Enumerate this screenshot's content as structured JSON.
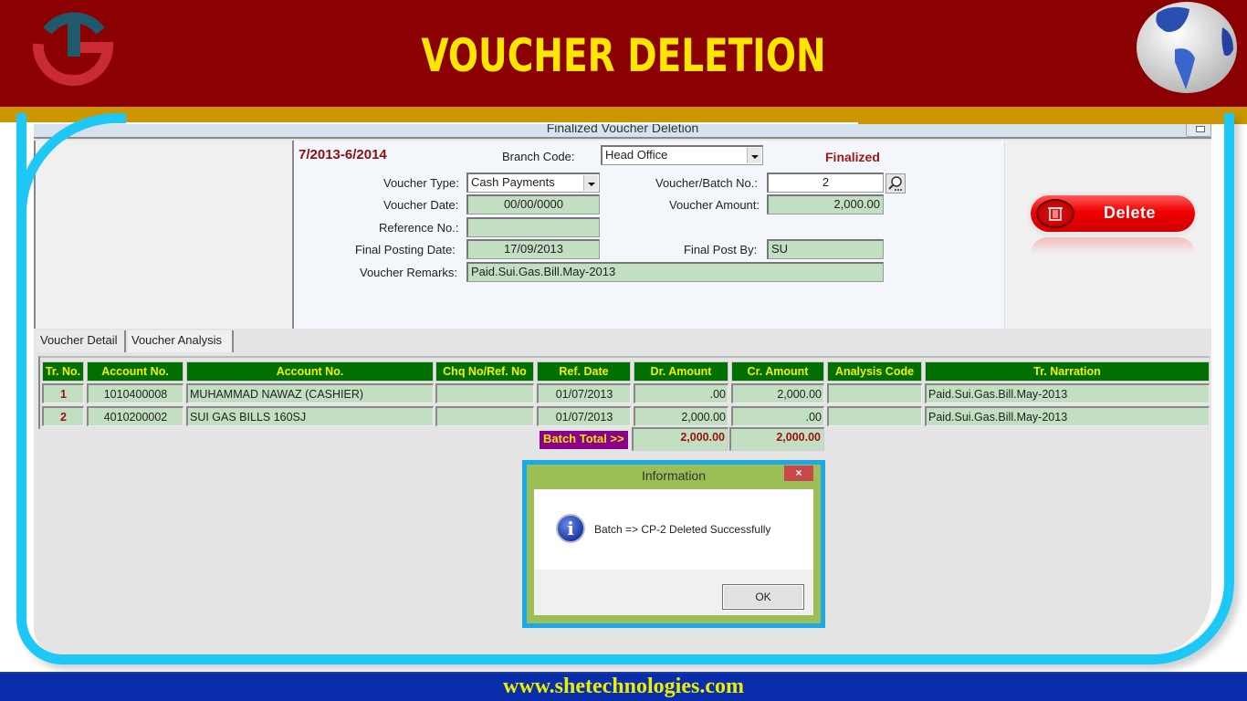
{
  "slide": {
    "title": "VOUCHER DELETION",
    "footer_url": "www.shetechnologies.com",
    "colors": {
      "header_bg": "#8b0000",
      "title": "#ffe600",
      "gold_band": "#cc9600",
      "frame": "#1ec8f6",
      "footer_bg": "#0a2eab"
    }
  },
  "window": {
    "title": "Finalized Voucher Deletion"
  },
  "form": {
    "period": "7/2013-6/2014",
    "status": "Finalized",
    "branch_code": {
      "label": "Branch Code:",
      "value": "Head Office"
    },
    "voucher_type": {
      "label": "Voucher Type:",
      "value": "Cash Payments"
    },
    "voucher_batch_no": {
      "label": "Voucher/Batch No.:",
      "value": "2"
    },
    "voucher_date": {
      "label": "Voucher Date:",
      "value": "00/00/0000"
    },
    "voucher_amount": {
      "label": "Voucher Amount:",
      "value": "2,000.00"
    },
    "reference_no": {
      "label": "Reference No.:",
      "value": ""
    },
    "final_posting_date": {
      "label": "Final Posting Date:",
      "value": "17/09/2013"
    },
    "final_post_by": {
      "label": "Final Post By:",
      "value": "SU"
    },
    "voucher_remarks": {
      "label": "Voucher Remarks:",
      "value": "Paid.Sui.Gas.Bill.May-2013"
    },
    "delete_label": "Delete"
  },
  "tabs": [
    {
      "label": "Voucher Detail",
      "active": true
    },
    {
      "label": "Voucher Analysis",
      "active": false
    }
  ],
  "grid": {
    "columns": [
      "Tr. No.",
      "Account No.",
      "Account No.",
      "Chq No/Ref. No",
      "Ref. Date",
      "Dr. Amount",
      "Cr. Amount",
      "Analysis Code",
      "Tr. Narration"
    ],
    "rows": [
      [
        "1",
        "1010400008",
        "MUHAMMAD NAWAZ (CASHIER)",
        "",
        "01/07/2013",
        ".00",
        "2,000.00",
        "",
        "Paid.Sui.Gas.Bill.May-2013"
      ],
      [
        "2",
        "4010200002",
        "SUI GAS BILLS 160SJ",
        "",
        "01/07/2013",
        "2,000.00",
        ".00",
        "",
        "Paid.Sui.Gas.Bill.May-2013"
      ]
    ],
    "batch_total_label": "Batch Total >>",
    "total_dr": "2,000.00",
    "total_cr": "2,000.00"
  },
  "dialog": {
    "title": "Information",
    "close": "×",
    "icon": "info-icon",
    "message": "Batch => CP-2  Deleted Successfully",
    "ok_label": "OK"
  }
}
